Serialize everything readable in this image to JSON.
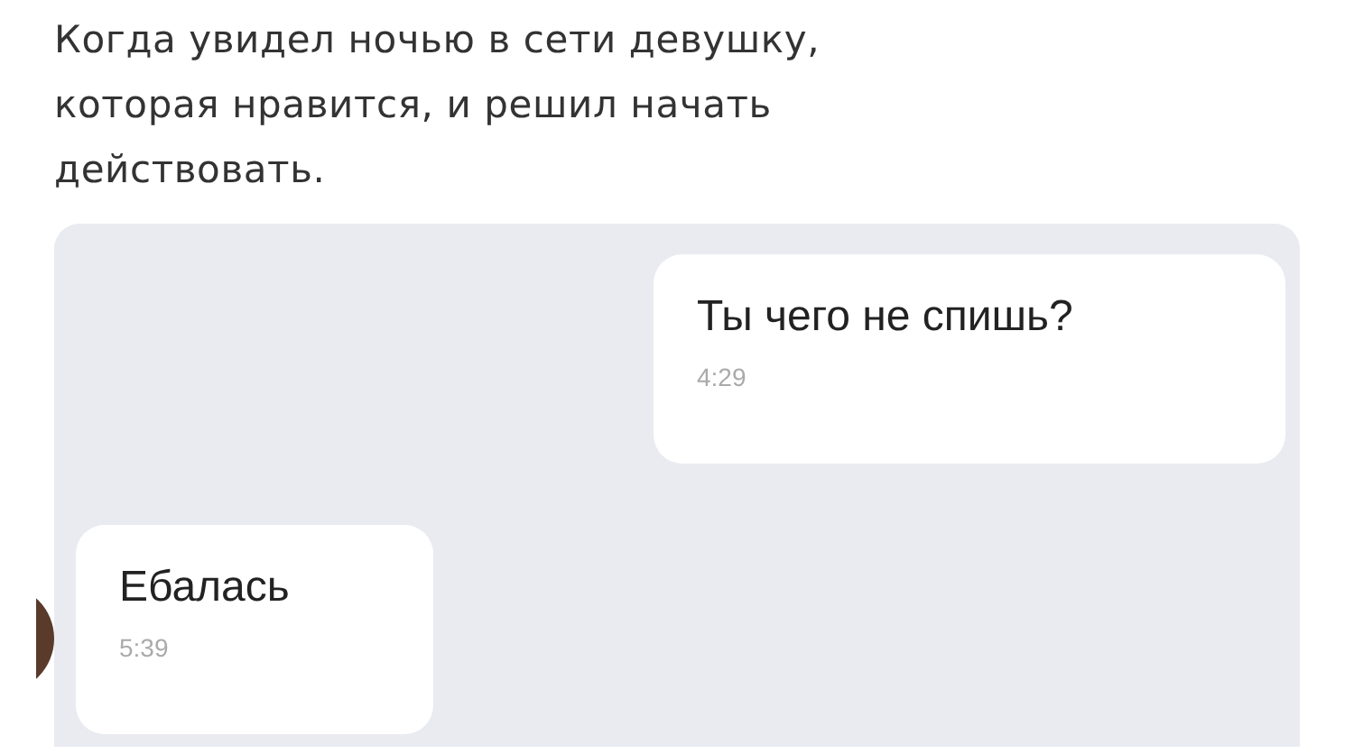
{
  "caption": "Когда увидел ночью в сети девушку, которая нравится, и решил начать действовать.",
  "messages": [
    {
      "kind": "outgoing",
      "text": "Ты чего не спишь?",
      "time": "4:29"
    },
    {
      "kind": "incoming",
      "text": "Ебалась",
      "time": "5:39"
    }
  ]
}
